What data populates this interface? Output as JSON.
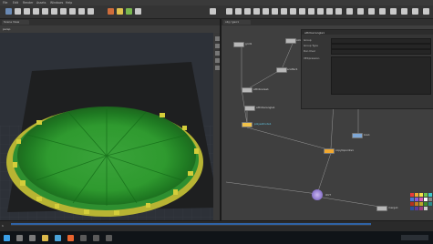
{
  "app": {
    "title": "Houdini",
    "accent": "#f0a830",
    "viewport_bg": "#2d3138",
    "network_bg": "#3f3f3f"
  },
  "menu": {
    "items": [
      "File",
      "Edit",
      "Render",
      "Assets",
      "Windows",
      "Help"
    ]
  },
  "viewport": {
    "header_label": "Scene View",
    "display": "persp"
  },
  "network": {
    "path": "obj / geo1",
    "nodes": [
      {
        "label": "grid1",
        "color": "gray"
      },
      {
        "label": "scatter1",
        "color": "gray"
      },
      {
        "label": "attribnoise1",
        "color": "gray"
      },
      {
        "label": "attribwrangle1",
        "color": "gray"
      },
      {
        "label": "color1",
        "color": "gray"
      },
      {
        "label": "polyextrude1",
        "color": "yellow"
      },
      {
        "label": "copytopoints1",
        "color": "orange"
      },
      {
        "label": "box1",
        "color": "blue"
      },
      {
        "label": "OUT",
        "color": "gray"
      },
      {
        "label": "merge1",
        "color": "gray"
      }
    ]
  },
  "params": {
    "title": "attribwrangle1",
    "rows": [
      "Group",
      "Group Type",
      "Run Over",
      "VEXpression"
    ]
  },
  "timeline": {
    "frame": "1"
  },
  "taskbar": {
    "icons": [
      "windows-icon",
      "search-icon",
      "taskview-icon",
      "explorer-icon",
      "browser-icon",
      "houdini-icon"
    ]
  }
}
